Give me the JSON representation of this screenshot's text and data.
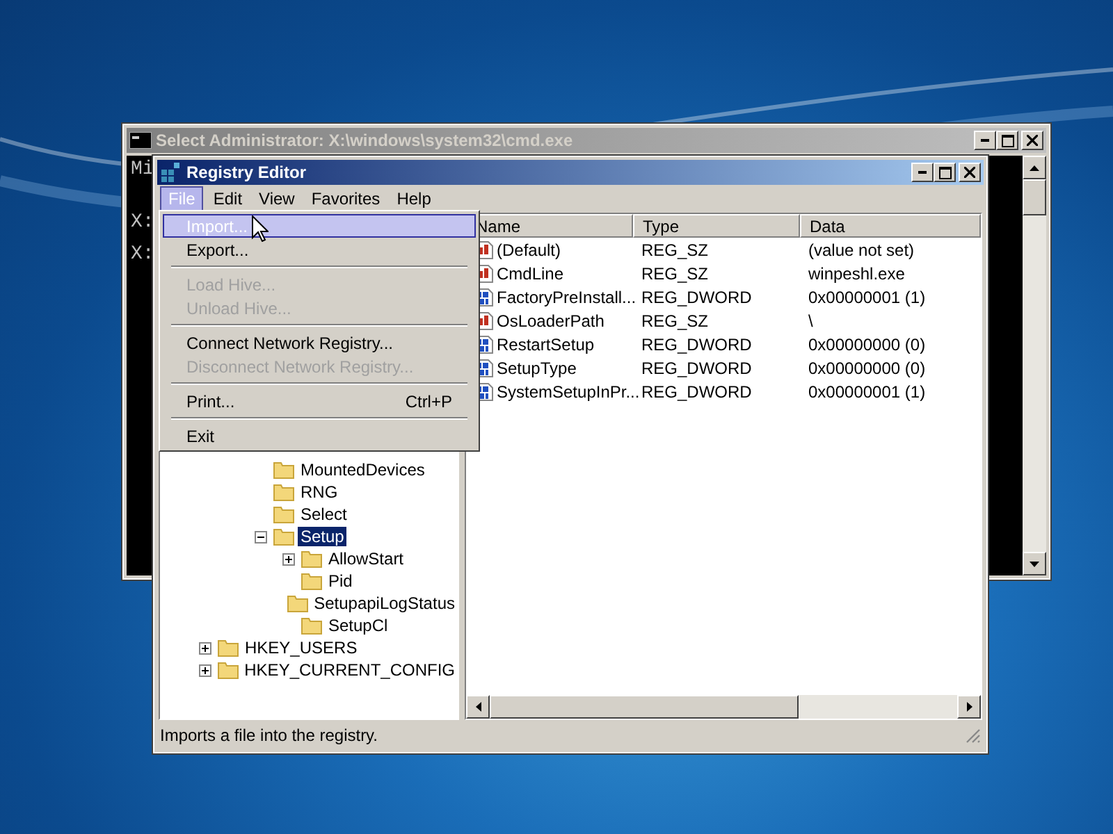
{
  "cmd_window": {
    "title": "Select Administrator: X:\\windows\\system32\\cmd.exe",
    "lines": [
      "Mi",
      "X:",
      "X:"
    ]
  },
  "regedit": {
    "title": "Registry Editor",
    "menu_bar": [
      {
        "label": "File",
        "selected": true
      },
      {
        "label": "Edit",
        "selected": false
      },
      {
        "label": "View",
        "selected": false
      },
      {
        "label": "Favorites",
        "selected": false
      },
      {
        "label": "Help",
        "selected": false
      }
    ],
    "file_menu": [
      {
        "kind": "item",
        "label": "Import...",
        "selected": true,
        "disabled": false
      },
      {
        "kind": "item",
        "label": "Export...",
        "selected": false,
        "disabled": false
      },
      {
        "kind": "separator"
      },
      {
        "kind": "item",
        "label": "Load Hive...",
        "selected": false,
        "disabled": true
      },
      {
        "kind": "item",
        "label": "Unload Hive...",
        "selected": false,
        "disabled": true
      },
      {
        "kind": "separator"
      },
      {
        "kind": "item",
        "label": "Connect Network Registry...",
        "selected": false,
        "disabled": false
      },
      {
        "kind": "item",
        "label": "Disconnect Network Registry...",
        "selected": false,
        "disabled": true
      },
      {
        "kind": "separator"
      },
      {
        "kind": "item",
        "label": "Print...",
        "shortcut": "Ctrl+P",
        "selected": false,
        "disabled": false
      },
      {
        "kind": "separator"
      },
      {
        "kind": "item",
        "label": "Exit",
        "selected": false,
        "disabled": false
      }
    ],
    "tree": {
      "items": [
        {
          "label": "MountedDevices",
          "selected": false
        },
        {
          "label": "RNG",
          "selected": false
        },
        {
          "label": "Select",
          "selected": false
        },
        {
          "label": "Setup",
          "selected": true,
          "expanded": true,
          "children": [
            {
              "label": "AllowStart",
              "selected": false,
              "expanded": false
            },
            {
              "label": "Pid",
              "selected": false
            },
            {
              "label": "SetupapiLogStatus",
              "selected": false
            },
            {
              "label": "SetupCl",
              "selected": false
            }
          ]
        }
      ],
      "roots": [
        {
          "label": "HKEY_USERS",
          "selected": false,
          "expanded": false
        },
        {
          "label": "HKEY_CURRENT_CONFIG",
          "selected": false,
          "expanded": false
        }
      ]
    },
    "values": {
      "columns": [
        "Name",
        "Type",
        "Data"
      ],
      "rows": [
        {
          "kind": "string",
          "name": "(Default)",
          "type": "REG_SZ",
          "data": "(value not set)"
        },
        {
          "kind": "string",
          "name": "CmdLine",
          "type": "REG_SZ",
          "data": "winpeshl.exe"
        },
        {
          "kind": "binary",
          "name": "FactoryPreInstall...",
          "type": "REG_DWORD",
          "data": "0x00000001 (1)"
        },
        {
          "kind": "string",
          "name": "OsLoaderPath",
          "type": "REG_SZ",
          "data": "\\"
        },
        {
          "kind": "binary",
          "name": "RestartSetup",
          "type": "REG_DWORD",
          "data": "0x00000000 (0)"
        },
        {
          "kind": "binary",
          "name": "SetupType",
          "type": "REG_DWORD",
          "data": "0x00000000 (0)"
        },
        {
          "kind": "binary",
          "name": "SystemSetupInPr...",
          "type": "REG_DWORD",
          "data": "0x00000001 (1)"
        }
      ]
    },
    "status_bar": "Imports a file into the registry."
  }
}
